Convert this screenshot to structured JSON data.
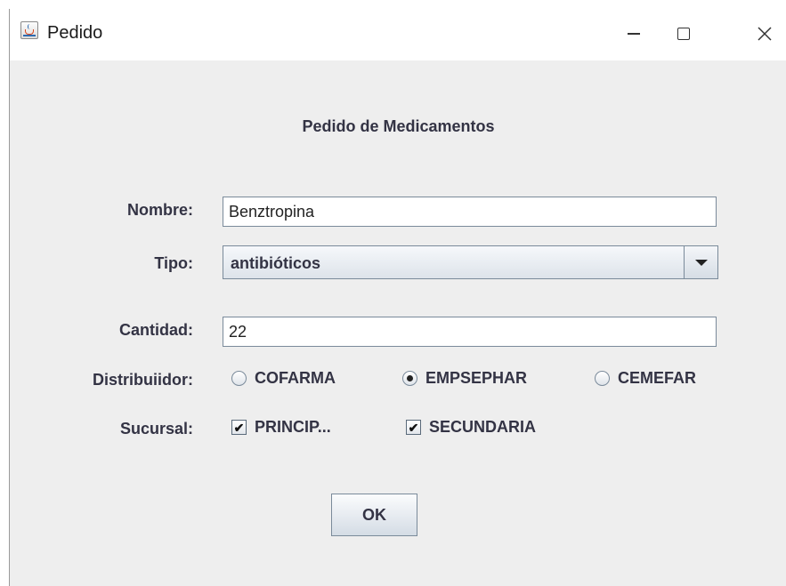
{
  "window": {
    "title": "Pedido",
    "icon": "java-cup-icon"
  },
  "form": {
    "heading": "Pedido de Medicamentos",
    "nombre": {
      "label": "Nombre:",
      "value": "Benztropina"
    },
    "tipo": {
      "label": "Tipo:",
      "selected": "antibióticos"
    },
    "cantidad": {
      "label": "Cantidad:",
      "value": "22"
    },
    "distribuidor": {
      "label": "Distribuiidor:",
      "options": [
        {
          "label": "COFARMA",
          "selected": false
        },
        {
          "label": "EMPSEPHAR",
          "selected": true
        },
        {
          "label": "CEMEFAR",
          "selected": false
        }
      ]
    },
    "sucursal": {
      "label": "Sucursal:",
      "options": [
        {
          "label": "PRINCIP...",
          "checked": true
        },
        {
          "label": "SECUNDARIA",
          "checked": true
        }
      ]
    },
    "ok_label": "OK"
  }
}
